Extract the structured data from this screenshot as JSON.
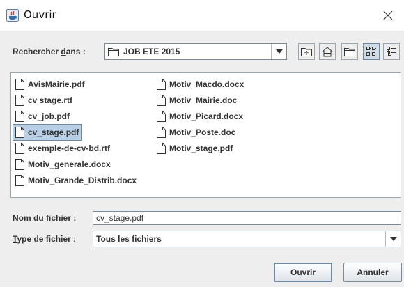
{
  "window": {
    "title": "Ouvrir"
  },
  "toolbar": {
    "look_in_label_pre": "Rechercher ",
    "look_in_label_mnemonic": "d",
    "look_in_label_post": "ans :",
    "current_folder": "JOB ETE 2015",
    "buttons": [
      "up-one-level",
      "home",
      "new-folder",
      "list-view",
      "details-view"
    ],
    "active_view": "list-view"
  },
  "files": {
    "column1": [
      "AvisMairie.pdf",
      "cv stage.rtf",
      "cv_job.pdf",
      "cv_stage.pdf",
      "exemple-de-cv-bd.rtf",
      "Motiv_generale.docx",
      "Motiv_Grande_Distrib.docx"
    ],
    "column2": [
      "Motiv_Macdo.docx",
      "Motiv_Mairie.doc",
      "Motiv_Picard.docx",
      "Motiv_Poste.doc",
      "Motiv_stage.pdf"
    ],
    "selected": "cv_stage.pdf"
  },
  "form": {
    "name_label_mnemonic": "N",
    "name_label_rest": "om du fichier :",
    "name_value": "cv_stage.pdf",
    "type_label_mnemonic": "T",
    "type_label_rest": "ype de fichier :",
    "type_value": "Tous les fichiers"
  },
  "actions": {
    "open_label": "Ouvrir",
    "cancel_label": "Annuler"
  },
  "colors": {
    "selection": "#b8cfe5",
    "background": "#eeeeee",
    "border": "#7a8a99"
  }
}
